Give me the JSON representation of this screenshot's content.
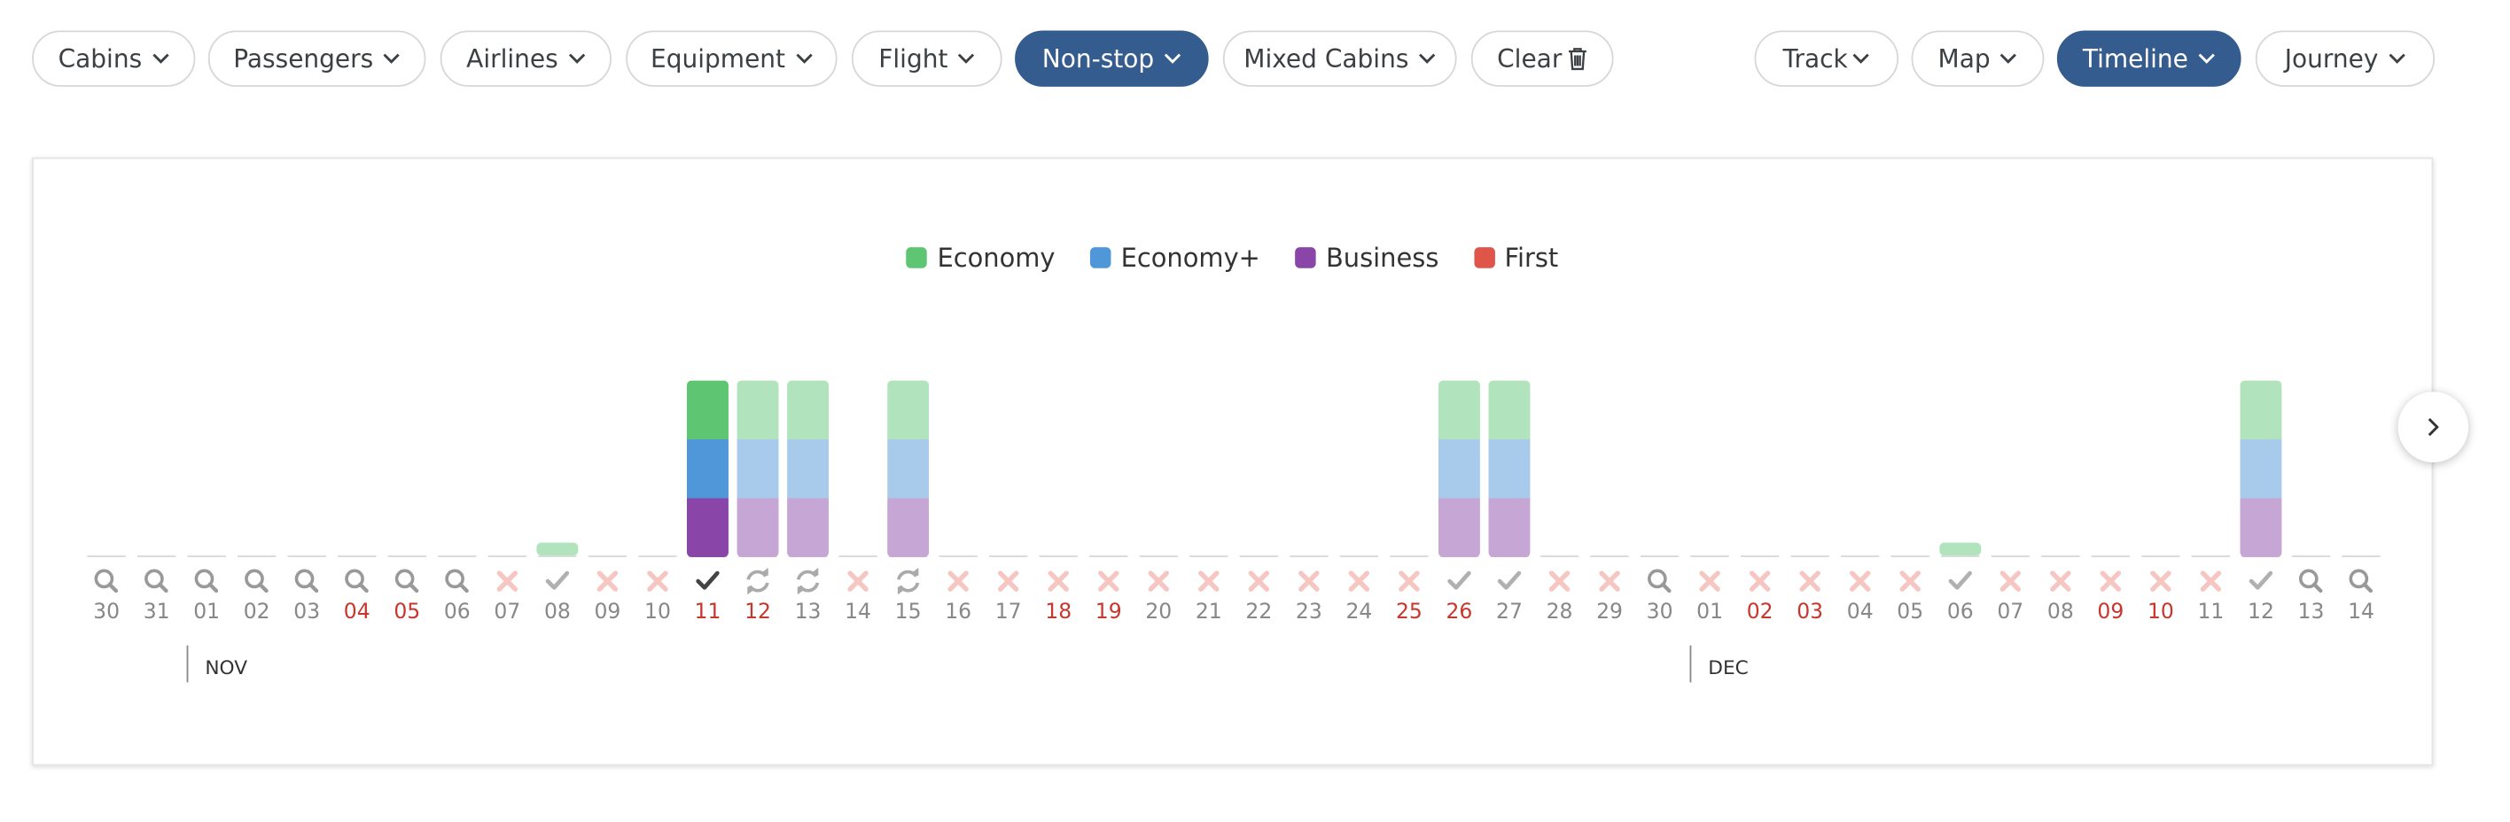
{
  "filters": [
    {
      "label": "Cabins",
      "active": false
    },
    {
      "label": "Passengers",
      "active": false
    },
    {
      "label": "Airlines",
      "active": false
    },
    {
      "label": "Equipment",
      "active": false
    },
    {
      "label": "Flight",
      "active": false
    },
    {
      "label": "Non-stop",
      "active": true
    },
    {
      "label": "Mixed Cabins",
      "active": false
    }
  ],
  "clear_label": "Clear",
  "views": [
    {
      "label": "Track",
      "active": false
    },
    {
      "label": "Map",
      "active": false
    },
    {
      "label": "Timeline",
      "active": true
    },
    {
      "label": "Journey",
      "active": false
    }
  ],
  "legend": [
    {
      "label": "Economy",
      "color": "#5ec573"
    },
    {
      "label": "Economy+",
      "color": "#4f97d8"
    },
    {
      "label": "Business",
      "color": "#8a45a8"
    },
    {
      "label": "First",
      "color": "#e0554a"
    }
  ],
  "colors": {
    "economy": "#5ec573",
    "economy_light": "#b1e4bc",
    "economy_plus": "#4f97d8",
    "economy_plus_light": "#a9cbeb",
    "business": "#8a45a8",
    "business_light": "#c5a6d5",
    "weekend": "#c8372d",
    "weekday": "#888888",
    "icon_search": "#999999",
    "icon_x": "#f6c7c2",
    "icon_check": "#b0b0b0",
    "icon_check_selected": "#444444",
    "icon_refresh": "#aaaaaa",
    "accent": "#355c8e"
  },
  "months": [
    {
      "label": "NOV",
      "start_index": 2
    },
    {
      "label": "DEC",
      "start_index": 32
    }
  ],
  "chart_data": {
    "type": "timeline",
    "days": [
      {
        "date": "30",
        "weekend": false,
        "status": "search",
        "bar": "none"
      },
      {
        "date": "31",
        "weekend": false,
        "status": "search",
        "bar": "none"
      },
      {
        "date": "01",
        "weekend": false,
        "status": "search",
        "bar": "none"
      },
      {
        "date": "02",
        "weekend": false,
        "status": "search",
        "bar": "none"
      },
      {
        "date": "03",
        "weekend": false,
        "status": "search",
        "bar": "none"
      },
      {
        "date": "04",
        "weekend": true,
        "status": "search",
        "bar": "none"
      },
      {
        "date": "05",
        "weekend": true,
        "status": "search",
        "bar": "none"
      },
      {
        "date": "06",
        "weekend": false,
        "status": "search",
        "bar": "none"
      },
      {
        "date": "07",
        "weekend": false,
        "status": "none",
        "bar": "none"
      },
      {
        "date": "08",
        "weekend": false,
        "status": "check",
        "bar": "stub"
      },
      {
        "date": "09",
        "weekend": false,
        "status": "none",
        "bar": "none"
      },
      {
        "date": "10",
        "weekend": false,
        "status": "none",
        "bar": "none"
      },
      {
        "date": "11",
        "weekend": true,
        "status": "check-selected",
        "bar": "full-selected"
      },
      {
        "date": "12",
        "weekend": true,
        "status": "refresh",
        "bar": "full"
      },
      {
        "date": "13",
        "weekend": false,
        "status": "refresh",
        "bar": "full"
      },
      {
        "date": "14",
        "weekend": false,
        "status": "none",
        "bar": "none"
      },
      {
        "date": "15",
        "weekend": false,
        "status": "refresh",
        "bar": "full"
      },
      {
        "date": "16",
        "weekend": false,
        "status": "none",
        "bar": "none"
      },
      {
        "date": "17",
        "weekend": false,
        "status": "none",
        "bar": "none"
      },
      {
        "date": "18",
        "weekend": true,
        "status": "none",
        "bar": "none"
      },
      {
        "date": "19",
        "weekend": true,
        "status": "none",
        "bar": "none"
      },
      {
        "date": "20",
        "weekend": false,
        "status": "none",
        "bar": "none"
      },
      {
        "date": "21",
        "weekend": false,
        "status": "none",
        "bar": "none"
      },
      {
        "date": "22",
        "weekend": false,
        "status": "none",
        "bar": "none"
      },
      {
        "date": "23",
        "weekend": false,
        "status": "none",
        "bar": "none"
      },
      {
        "date": "24",
        "weekend": false,
        "status": "none",
        "bar": "none"
      },
      {
        "date": "25",
        "weekend": true,
        "status": "none",
        "bar": "none"
      },
      {
        "date": "26",
        "weekend": true,
        "status": "check",
        "bar": "full"
      },
      {
        "date": "27",
        "weekend": false,
        "status": "check",
        "bar": "full"
      },
      {
        "date": "28",
        "weekend": false,
        "status": "none",
        "bar": "none"
      },
      {
        "date": "29",
        "weekend": false,
        "status": "none",
        "bar": "none"
      },
      {
        "date": "30",
        "weekend": false,
        "status": "search",
        "bar": "none"
      },
      {
        "date": "01",
        "weekend": false,
        "status": "none",
        "bar": "none"
      },
      {
        "date": "02",
        "weekend": true,
        "status": "none",
        "bar": "none"
      },
      {
        "date": "03",
        "weekend": true,
        "status": "none",
        "bar": "none"
      },
      {
        "date": "04",
        "weekend": false,
        "status": "none",
        "bar": "none"
      },
      {
        "date": "05",
        "weekend": false,
        "status": "none",
        "bar": "none"
      },
      {
        "date": "06",
        "weekend": false,
        "status": "check",
        "bar": "stub"
      },
      {
        "date": "07",
        "weekend": false,
        "status": "none",
        "bar": "none"
      },
      {
        "date": "08",
        "weekend": false,
        "status": "none",
        "bar": "none"
      },
      {
        "date": "09",
        "weekend": true,
        "status": "none",
        "bar": "none"
      },
      {
        "date": "10",
        "weekend": true,
        "status": "none",
        "bar": "none"
      },
      {
        "date": "11",
        "weekend": false,
        "status": "none",
        "bar": "none"
      },
      {
        "date": "12",
        "weekend": false,
        "status": "check",
        "bar": "full"
      },
      {
        "date": "13",
        "weekend": false,
        "status": "search",
        "bar": "none"
      },
      {
        "date": "14",
        "weekend": false,
        "status": "search",
        "bar": "none"
      }
    ]
  }
}
